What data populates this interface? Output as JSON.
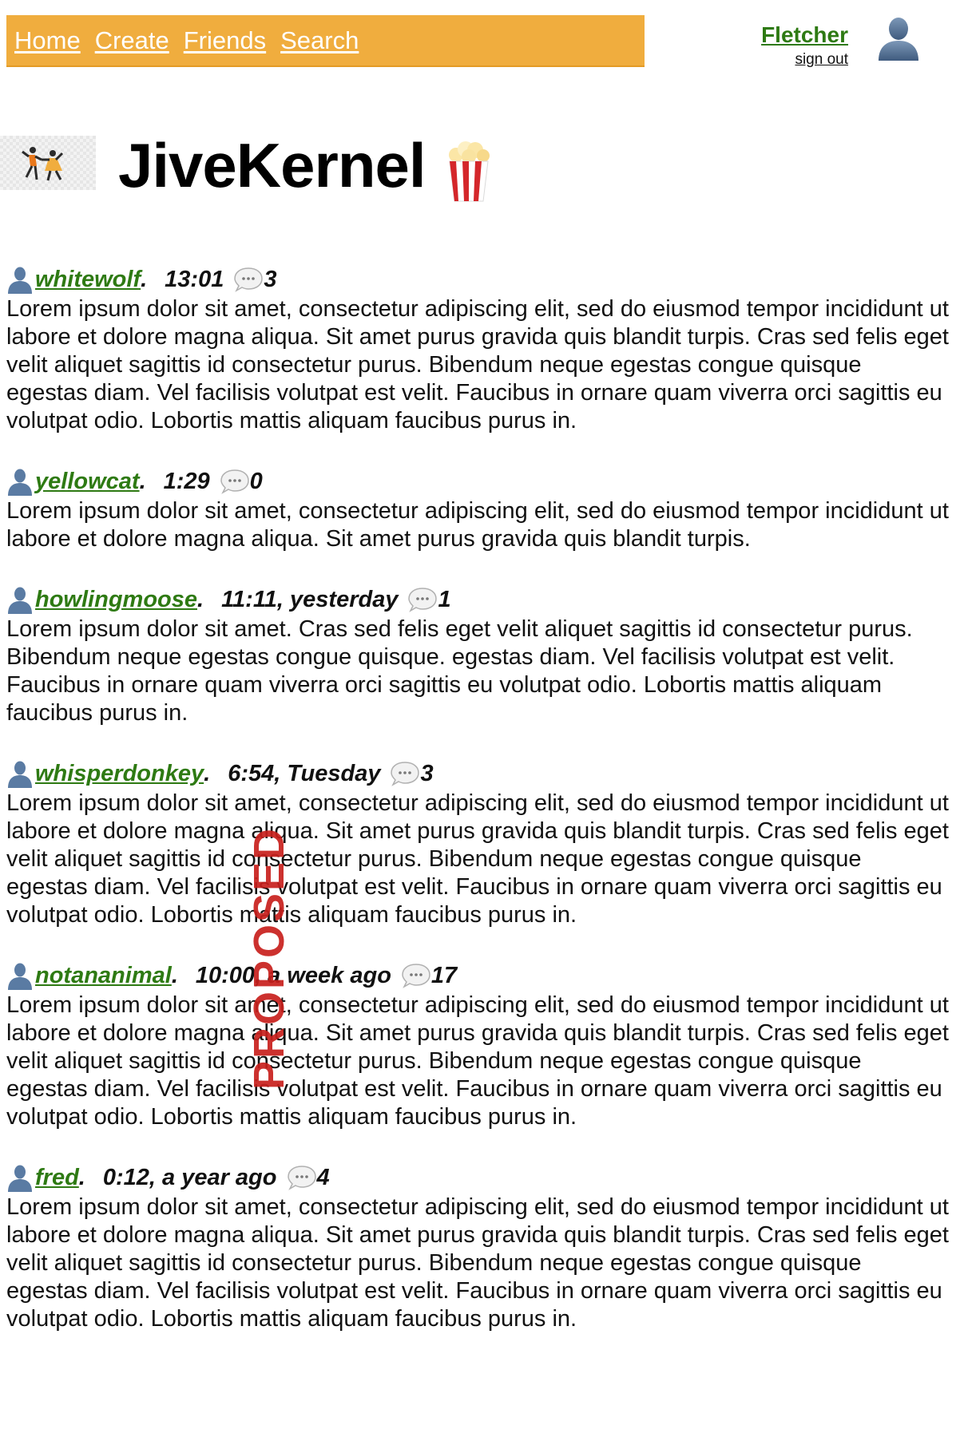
{
  "nav": {
    "items": [
      {
        "label": "Home"
      },
      {
        "label": "Create"
      },
      {
        "label": "Friends"
      },
      {
        "label": "Search"
      }
    ]
  },
  "user": {
    "name": "Fletcher",
    "sign_out_label": "sign out",
    "avatar_icon": "user-silhouette-icon"
  },
  "header": {
    "title": "JiveKernel",
    "logo_icon": "dancing-couple-icon",
    "title_icon": "popcorn-icon"
  },
  "posts": [
    {
      "author": "whitewolf",
      "time": "13:01",
      "comments": "3",
      "body": "Lorem ipsum dolor sit amet, consectetur adipiscing elit, sed do eiusmod tempor incididunt ut labore et dolore magna aliqua. Sit amet purus gravida quis blandit turpis. Cras sed felis eget velit aliquet sagittis id consectetur purus. Bibendum neque egestas congue quisque egestas diam. Vel facilisis volutpat est velit. Faucibus in ornare quam viverra orci sagittis eu volutpat odio. Lobortis mattis aliquam faucibus purus in."
    },
    {
      "author": "yellowcat",
      "time": "1:29",
      "comments": "0",
      "body": "Lorem ipsum dolor sit amet, consectetur adipiscing elit, sed do eiusmod tempor incididunt ut labore et dolore magna aliqua. Sit amet purus gravida quis blandit turpis."
    },
    {
      "author": "howlingmoose",
      "time": "11:11, yesterday",
      "comments": "1",
      "body": "Lorem ipsum dolor sit amet. Cras sed felis eget velit aliquet sagittis id consectetur purus. Bibendum neque egestas congue quisque. egestas diam. Vel facilisis volutpat est velit. Faucibus in ornare quam viverra orci sagittis eu volutpat odio. Lobortis mattis aliquam faucibus purus in."
    },
    {
      "author": "whisperdonkey",
      "time": "6:54, Tuesday",
      "comments": "3",
      "body": "Lorem ipsum dolor sit amet, consectetur adipiscing elit, sed do eiusmod tempor incididunt ut labore et dolore magna aliqua. Sit amet purus gravida quis blandit turpis. Cras sed felis eget velit aliquet sagittis id consectetur purus. Bibendum neque egestas congue quisque egestas diam. Vel facilisis volutpat est velit. Faucibus in ornare quam viverra orci sagittis eu volutpat odio. Lobortis mattis aliquam faucibus purus in."
    },
    {
      "author": "notananimal",
      "time": "10:00, a week ago",
      "comments": "17",
      "body": "Lorem ipsum dolor sit amet, consectetur adipiscing elit, sed do eiusmod tempor incididunt ut labore et dolore magna aliqua. Sit amet purus gravida quis blandit turpis. Cras sed felis eget velit aliquet sagittis id consectetur purus. Bibendum neque egestas congue quisque egestas diam. Vel facilisis volutpat est velit. Faucibus in ornare quam viverra orci sagittis eu volutpat odio. Lobortis mattis aliquam faucibus purus in."
    },
    {
      "author": "fred",
      "time": "0:12, a year ago",
      "comments": "4",
      "body": "Lorem ipsum dolor sit amet, consectetur adipiscing elit, sed do eiusmod tempor incididunt ut labore et dolore magna aliqua. Sit amet purus gravida quis blandit turpis. Cras sed felis eget velit aliquet sagittis id consectetur purus. Bibendum neque egestas congue quisque egestas diam. Vel facilisis volutpat est velit. Faucibus in ornare quam viverra orci sagittis eu volutpat odio. Lobortis mattis aliquam faucibus purus in."
    }
  ],
  "post_icons": {
    "author_icon": "user-silhouette-icon",
    "comment_icon": "speech-bubble-icon"
  },
  "watermark": "PROPOSED",
  "colors": {
    "nav_bg": "#f0ad3e",
    "link_green": "#2e7a13",
    "watermark_red": "#c8201c"
  }
}
